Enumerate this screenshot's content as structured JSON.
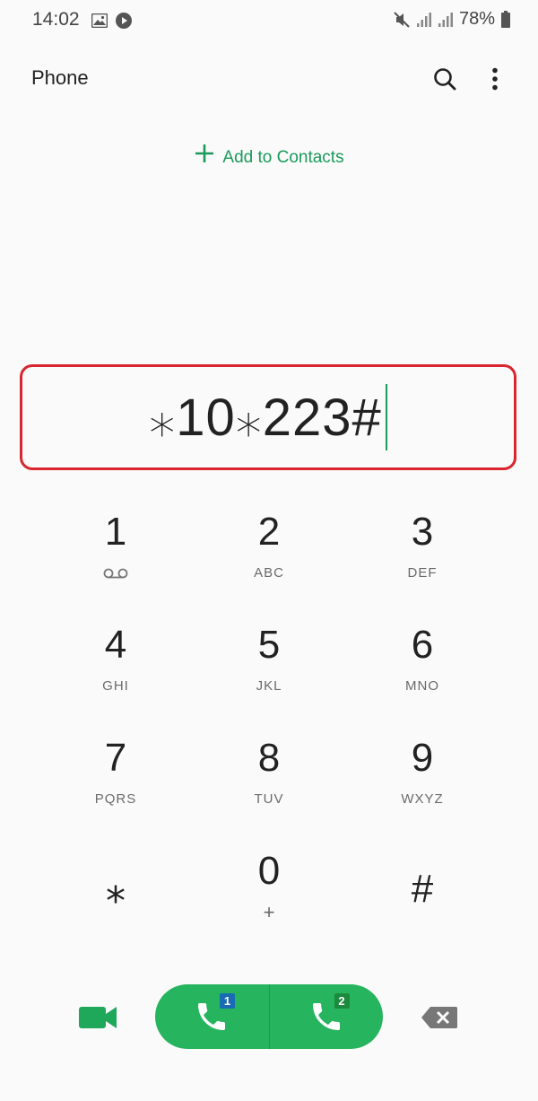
{
  "status_bar": {
    "time": "14:02",
    "battery": "78%",
    "icons": [
      "gallery-icon",
      "play-icon",
      "mute-icon",
      "signal-icon",
      "signal-icon",
      "battery-icon"
    ]
  },
  "app_bar": {
    "title": "Phone",
    "icons": [
      "search-icon",
      "more-vert-icon"
    ]
  },
  "add_contact": {
    "label": "Add to Contacts",
    "icon": "plus-icon",
    "color": "#1a9a5a"
  },
  "dialer": {
    "number": "⁎10⁎223#",
    "highlight_color": "#d9252f"
  },
  "keypad": {
    "keys": [
      {
        "digit": "1",
        "letters": "",
        "icon": "voicemail-icon"
      },
      {
        "digit": "2",
        "letters": "ABC"
      },
      {
        "digit": "3",
        "letters": "DEF"
      },
      {
        "digit": "4",
        "letters": "GHI"
      },
      {
        "digit": "5",
        "letters": "JKL"
      },
      {
        "digit": "6",
        "letters": "MNO"
      },
      {
        "digit": "7",
        "letters": "PQRS"
      },
      {
        "digit": "8",
        "letters": "TUV"
      },
      {
        "digit": "9",
        "letters": "WXYZ"
      },
      {
        "digit": "⁎",
        "letters": ""
      },
      {
        "digit": "0",
        "letters": "+"
      },
      {
        "digit": "#",
        "letters": ""
      }
    ]
  },
  "actions": {
    "video_icon": "video-call-icon",
    "call_sim1_badge": "1",
    "call_sim2_badge": "2",
    "call_color": "#27b45f",
    "backspace_icon": "backspace-icon"
  }
}
